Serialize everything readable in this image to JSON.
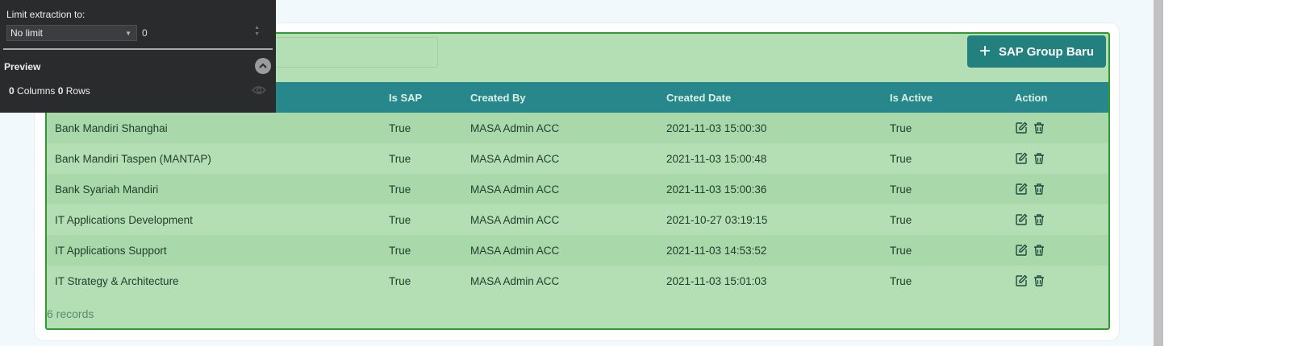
{
  "toolbar": {
    "add_button_label": "SAP Group Baru",
    "search_placeholder": ""
  },
  "table": {
    "headers": [
      "",
      "Is SAP",
      "Created By",
      "Created Date",
      "Is Active",
      "Action"
    ],
    "rows": [
      {
        "name": "Bank Mandiri Shanghai",
        "is_sap": "True",
        "created_by": "MASA Admin ACC",
        "created_date": "2021-11-03 15:00:30",
        "is_active": "True"
      },
      {
        "name": "Bank Mandiri Taspen (MANTAP)",
        "is_sap": "True",
        "created_by": "MASA Admin ACC",
        "created_date": "2021-11-03 15:00:48",
        "is_active": "True"
      },
      {
        "name": "Bank Syariah Mandiri",
        "is_sap": "True",
        "created_by": "MASA Admin ACC",
        "created_date": "2021-11-03 15:00:36",
        "is_active": "True"
      },
      {
        "name": "IT Applications Development",
        "is_sap": "True",
        "created_by": "MASA Admin ACC",
        "created_date": "2021-10-27 03:19:15",
        "is_active": "True"
      },
      {
        "name": "IT Applications Support",
        "is_sap": "True",
        "created_by": "MASA Admin ACC",
        "created_date": "2021-11-03 14:53:52",
        "is_active": "True"
      },
      {
        "name": "IT Strategy & Architecture",
        "is_sap": "True",
        "created_by": "MASA Admin ACC",
        "created_date": "2021-11-03 15:01:03",
        "is_active": "True"
      }
    ],
    "records_label": "6 records"
  },
  "panel": {
    "limit_label": "Limit extraction to:",
    "limit_value": "No limit",
    "limit_number": "0",
    "preview_title": "Preview",
    "columns_count": "0",
    "columns_label": " Columns ",
    "rows_count": "0",
    "rows_label": " Rows"
  },
  "colors": {
    "primary": "#22817f",
    "header_bg": "#27878a",
    "highlight_fill": "#b4dfb4",
    "highlight_border": "#2f9a2f",
    "panel_bg": "#2a2b2d"
  },
  "icons": {
    "add": "plus-icon",
    "edit": "edit-icon",
    "delete": "trash-icon",
    "collapse": "chevron-up-icon",
    "visibility": "eye-icon"
  }
}
